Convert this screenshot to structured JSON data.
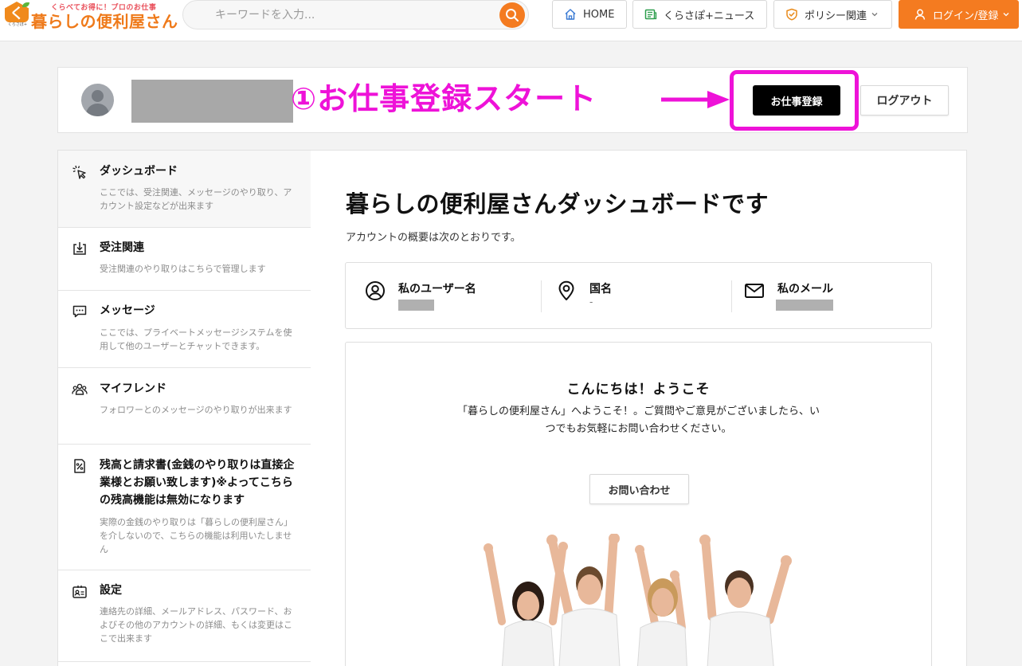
{
  "header": {
    "logo": {
      "tagline": "くらべてお得に！プロのお仕事",
      "name": "暮らしの便利屋さん",
      "badge_char": "く",
      "badge_sub": "くらさぽ+"
    },
    "search": {
      "placeholder": "キーワードを入力..."
    },
    "nav": {
      "home": "HOME",
      "news": "くらさぽ+ニュース",
      "policy": "ポリシー関連",
      "login": "ログイン/登録"
    }
  },
  "profile": {
    "annotation": "①お仕事登録スタート",
    "job_button": "お仕事登録",
    "logout_button": "ログアウト"
  },
  "sidebar": {
    "items": [
      {
        "title": "ダッシュボード",
        "desc": "ここでは、受注関連、メッセージのやり取り、アカウント設定などが出来ます"
      },
      {
        "title": "受注関連",
        "desc": "受注関連のやり取りはこちらで管理します"
      },
      {
        "title": "メッセージ",
        "desc": "ここでは、プライベートメッセージシステムを使用して他のユーザーとチャットできます。"
      },
      {
        "title": "マイフレンド",
        "desc": "フォロワーとのメッセージのやり取りが出来ます"
      },
      {
        "title": "残高と請求書(金銭のやり取りは直接企業様とお願い致します)※よってこちらの残高機能は無効になります",
        "desc": "実際の金銭のやり取りは「暮らしの便利屋さん」を介しないので、こちらの機能は利用いたしません"
      },
      {
        "title": "設定",
        "desc": "連絡先の詳細、メールアドレス、パスワード、およびその他のアカウントの詳細、もくは変更はここで出来ます"
      }
    ]
  },
  "main": {
    "title": "暮らしの便利屋さんダッシュボードです",
    "subtitle": "アカウントの概要は次のとおりです。",
    "info": {
      "username_label": "私のユーザー名",
      "country_label": "国名",
      "country_value": "-",
      "email_label": "私のメール"
    },
    "welcome": {
      "title": "こんにちは！ようこそ",
      "text": "「暮らしの便利屋さん」へようこそ！。ご質問やご意見がございましたら、いつでもお気軽にお問い合わせください。",
      "contact_button": "お問い合わせ"
    }
  },
  "colors": {
    "accent_orange": "#f47b20",
    "annotation_magenta": "#ee12d8",
    "primary_black": "#000000"
  },
  "icons": {
    "search": "search-icon",
    "home": "home-icon",
    "news": "newspaper-icon",
    "policy": "shield-check-icon",
    "login": "user-icon",
    "dashboard": "cursor-click-icon",
    "orders": "download-box-icon",
    "messages": "chat-bubble-icon",
    "friends": "users-icon",
    "balance": "invoice-icon",
    "settings": "id-card-icon",
    "username": "user-circle-icon",
    "country": "map-pin-icon",
    "email": "mail-icon"
  }
}
